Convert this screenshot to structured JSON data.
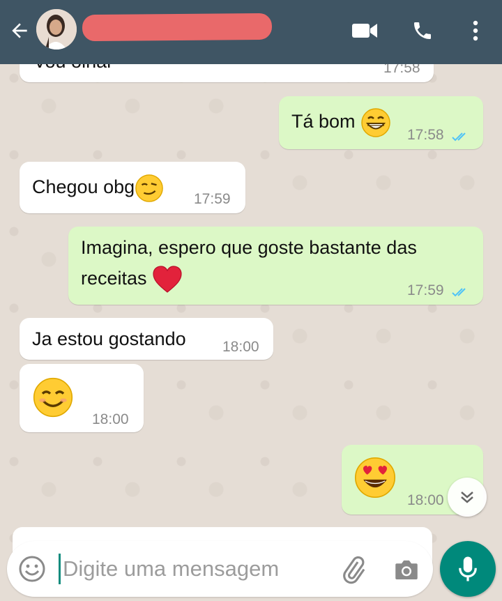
{
  "header": {
    "contact_name_redacted": true,
    "accent_color": "#3f5564",
    "icons": [
      "back-arrow-icon",
      "avatar",
      "video-call-icon",
      "phone-icon",
      "more-vert-icon"
    ]
  },
  "messages": [
    {
      "id": 0,
      "direction": "in",
      "text": "Vou olhar",
      "time": "17:58"
    },
    {
      "id": 1,
      "direction": "out",
      "text": "Tá bom",
      "emoji": "grinning-face",
      "time": "17:58",
      "read": true
    },
    {
      "id": 2,
      "direction": "in",
      "text": "Chegou obg",
      "emoji": "smirking-face",
      "time": "17:59"
    },
    {
      "id": 3,
      "direction": "out",
      "text_line1": "Imagina, espero que goste bastante das",
      "text_line2": "receitas",
      "emoji": "red-heart",
      "time": "17:59",
      "read": true
    },
    {
      "id": 4,
      "direction": "in",
      "text": "Ja estou gostando",
      "time": "18:00"
    },
    {
      "id": 5,
      "direction": "in",
      "emoji": "smiling-face",
      "time": "18:00"
    },
    {
      "id": 6,
      "direction": "out",
      "emoji": "heart-eyes-face",
      "time": "18:00"
    }
  ],
  "input": {
    "placeholder": "Digite uma mensagem",
    "value": ""
  },
  "colors": {
    "incoming": "#ffffff",
    "outgoing": "#dcf8c6",
    "read_ticks": "#4fc3f7",
    "mic_button": "#00897b"
  }
}
